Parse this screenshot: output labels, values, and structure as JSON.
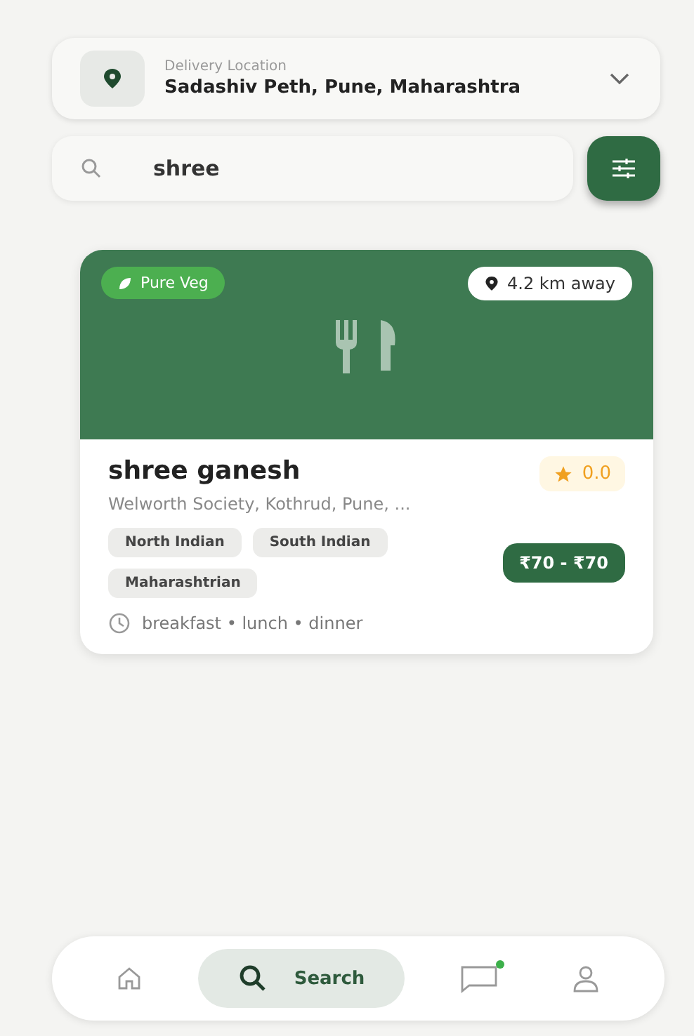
{
  "location": {
    "label": "Delivery Location",
    "value": "Sadashiv Peth, Pune, Maharashtra"
  },
  "search": {
    "value": "shree"
  },
  "results": [
    {
      "badge": "Pure Veg",
      "distance": "4.2 km away",
      "name": "shree ganesh",
      "rating": "0.0",
      "address": "Welworth Society, Kothrud, Pune, ...",
      "cuisines": [
        "North Indian",
        "South Indian",
        "Maharashtrian"
      ],
      "price": "₹70 - ₹70",
      "meals": "breakfast • lunch • dinner"
    }
  ],
  "nav": [
    {
      "kind": "home",
      "selected": false,
      "unread": false
    },
    {
      "kind": "search",
      "label": "Search",
      "selected": true,
      "unread": false
    },
    {
      "kind": "chat",
      "selected": false,
      "unread": true
    },
    {
      "kind": "profile",
      "selected": false,
      "unread": false
    }
  ]
}
